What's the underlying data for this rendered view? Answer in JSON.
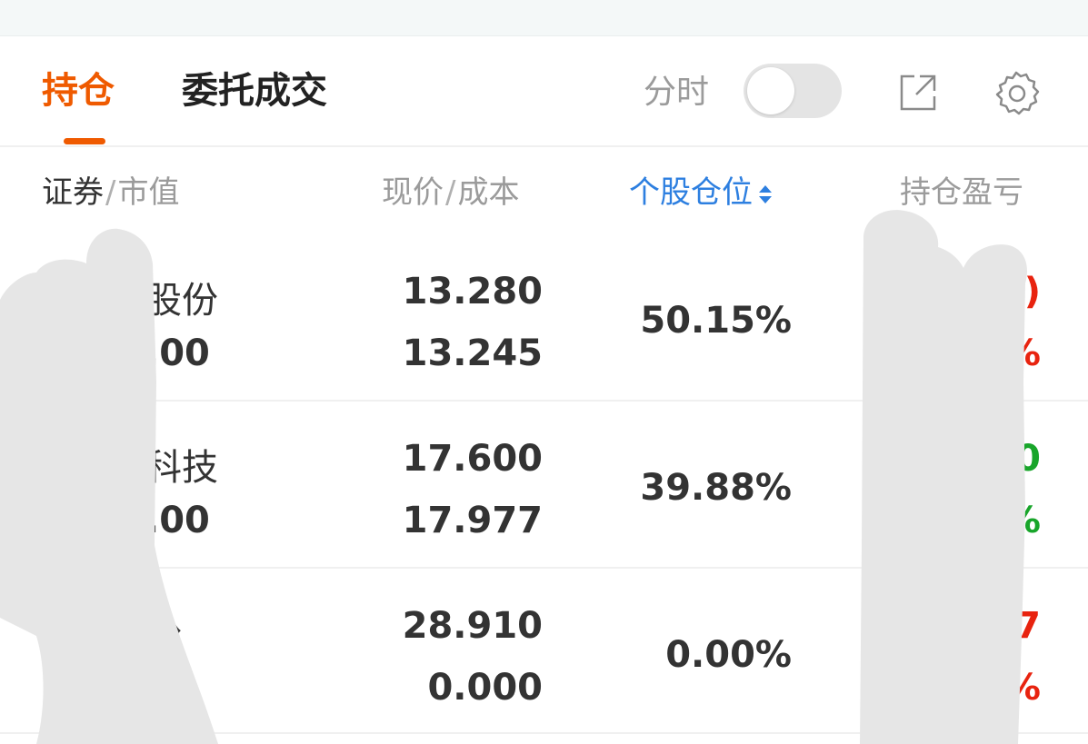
{
  "tabs": {
    "holdings": "持仓",
    "orders": "委托成交"
  },
  "header": {
    "time_share_label": "分时",
    "time_share_enabled": false,
    "share_icon": "external-link-icon",
    "settings_icon": "gear-icon"
  },
  "columns": {
    "security": "证券",
    "sep1": "/",
    "market_value": "市值",
    "price": "现价",
    "sep2": "/",
    "cost": "成本",
    "position": "个股仓位",
    "pnl": "持仓盈亏"
  },
  "rows": [
    {
      "name": "股份",
      "market_value": ".00",
      "price": "13.280",
      "cost": "13.245",
      "position_pct": "50.15%",
      "pnl": ")",
      "pnl_rate": "%",
      "pnl_color": "#e8230f"
    },
    {
      "name": "科技",
      "market_value": ".00",
      "price": "17.600",
      "cost": "17.977",
      "position_pct": "39.88%",
      "pnl": "0",
      "pnl_rate": "%",
      "pnl_color": "#18a52a"
    },
    {
      "name": "份",
      "market_value": "",
      "price": "28.910",
      "cost": "0.000",
      "position_pct": "0.00%",
      "pnl": "7",
      "pnl_rate": "%",
      "pnl_color": "#e8230f"
    }
  ],
  "colors": {
    "accent": "#ef5a00",
    "link_blue": "#2d7fe0",
    "up_red": "#e8230f",
    "down_green": "#18a52a"
  }
}
